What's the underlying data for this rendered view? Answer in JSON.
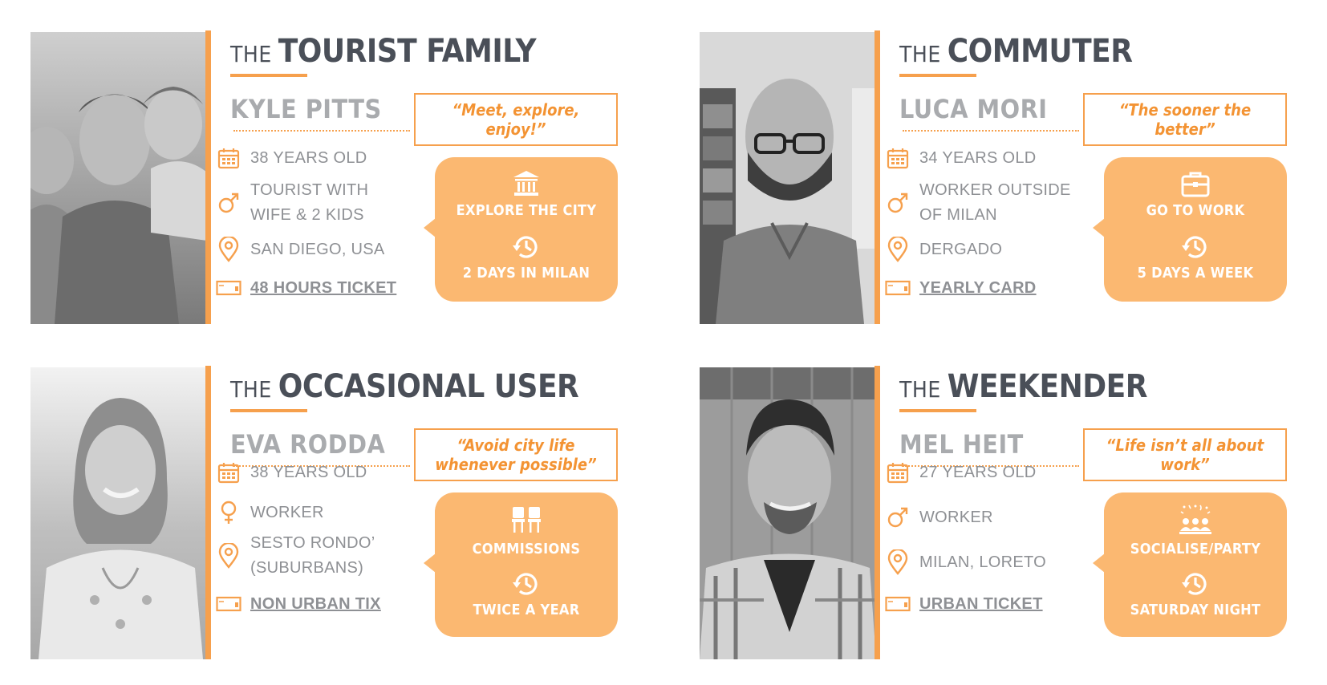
{
  "colors": {
    "accent": "#f6a04d",
    "bubble": "#fbb871",
    "quote": "#f39333",
    "title": "#4a4f58",
    "text": "#8e9094",
    "name": "#a9abae"
  },
  "personas": [
    {
      "title_prefix": "THE",
      "title_main": "TOURIST FAMILY",
      "name": "KYLE PITTS",
      "quote": "“Meet, explore, enjoy!”",
      "age": "38 YEARS OLD",
      "gender_icon": "male-icon",
      "role": "TOURIST WITH\nWIFE & 2 KIDS",
      "location": "SAN DIEGO, USA",
      "ticket": "48 HOURS TICKET",
      "goal_icon": "museum-icon",
      "goal": "EXPLORE THE CITY",
      "frequency": "2 DAYS IN MILAN"
    },
    {
      "title_prefix": "THE",
      "title_main": "COMMUTER",
      "name": "LUCA MORI",
      "quote": "“The sooner the better”",
      "age": "34 YEARS OLD",
      "gender_icon": "male-icon",
      "role": "WORKER OUTSIDE\nOF MILAN",
      "location": "DERGADO",
      "ticket": "YEARLY CARD",
      "goal_icon": "briefcase-icon",
      "goal": "GO TO WORK",
      "frequency": "5 DAYS A WEEK"
    },
    {
      "title_prefix": "THE",
      "title_main": "OCCASIONAL USER",
      "name": "EVA RODDA",
      "quote": "“Avoid city life\nwhenever possible”",
      "age": "38 YEARS OLD",
      "gender_icon": "female-icon",
      "role": "WORKER",
      "location": "SESTO RONDO’\n(SUBURBANS)",
      "ticket": "NON URBAN TIX",
      "goal_icon": "chairs-icon",
      "goal": "COMMISSIONS",
      "frequency": "TWICE A YEAR"
    },
    {
      "title_prefix": "THE",
      "title_main": "WEEKENDER",
      "name": "MEL HEIT",
      "quote": "“Life isn’t all about\nwork”",
      "age": "27 YEARS OLD",
      "gender_icon": "male-icon",
      "role": "WORKER",
      "location": "MILAN, LORETO",
      "ticket": "URBAN TICKET",
      "goal_icon": "party-icon",
      "goal": "SOCIALISE/PARTY",
      "frequency": "SATURDAY NIGHT"
    }
  ]
}
